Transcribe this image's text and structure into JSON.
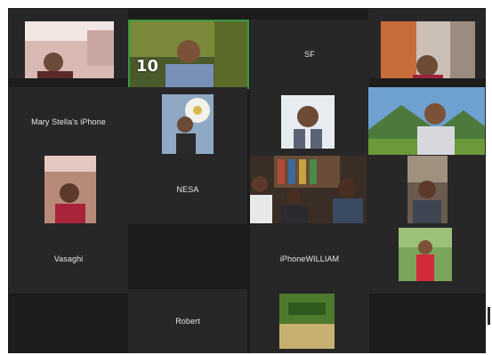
{
  "meeting": {
    "participants": [
      {
        "name": "",
        "has_video": true,
        "speaking": false
      },
      {
        "name": "",
        "has_video": true,
        "speaking": true,
        "overlay_text": "10"
      },
      {
        "name": "SF",
        "has_video": false
      },
      {
        "name": "",
        "has_video": true
      },
      {
        "name": "Mary Stella's iPhone",
        "has_video": false
      },
      {
        "name": "",
        "has_video": true
      },
      {
        "name": "",
        "has_video": true
      },
      {
        "name": "",
        "has_video": true
      },
      {
        "name": "",
        "has_video": true
      },
      {
        "name": "NESA",
        "has_video": false
      },
      {
        "name": "",
        "has_video": true
      },
      {
        "name": "",
        "has_video": true
      },
      {
        "name": "Vasaghi",
        "has_video": false
      },
      {
        "name": "iPhoneWILLIAM",
        "has_video": false
      },
      {
        "name": "",
        "has_video": true
      },
      {
        "name": "Robert",
        "has_video": false
      },
      {
        "name": "",
        "has_video": true
      }
    ]
  },
  "colors": {
    "page_background": "#ffffff",
    "stage_background": "#1c1c1c",
    "tile_background": "#272727",
    "active_speaker_border": "#3a9a3e",
    "name_text": "#e6e6e6"
  }
}
